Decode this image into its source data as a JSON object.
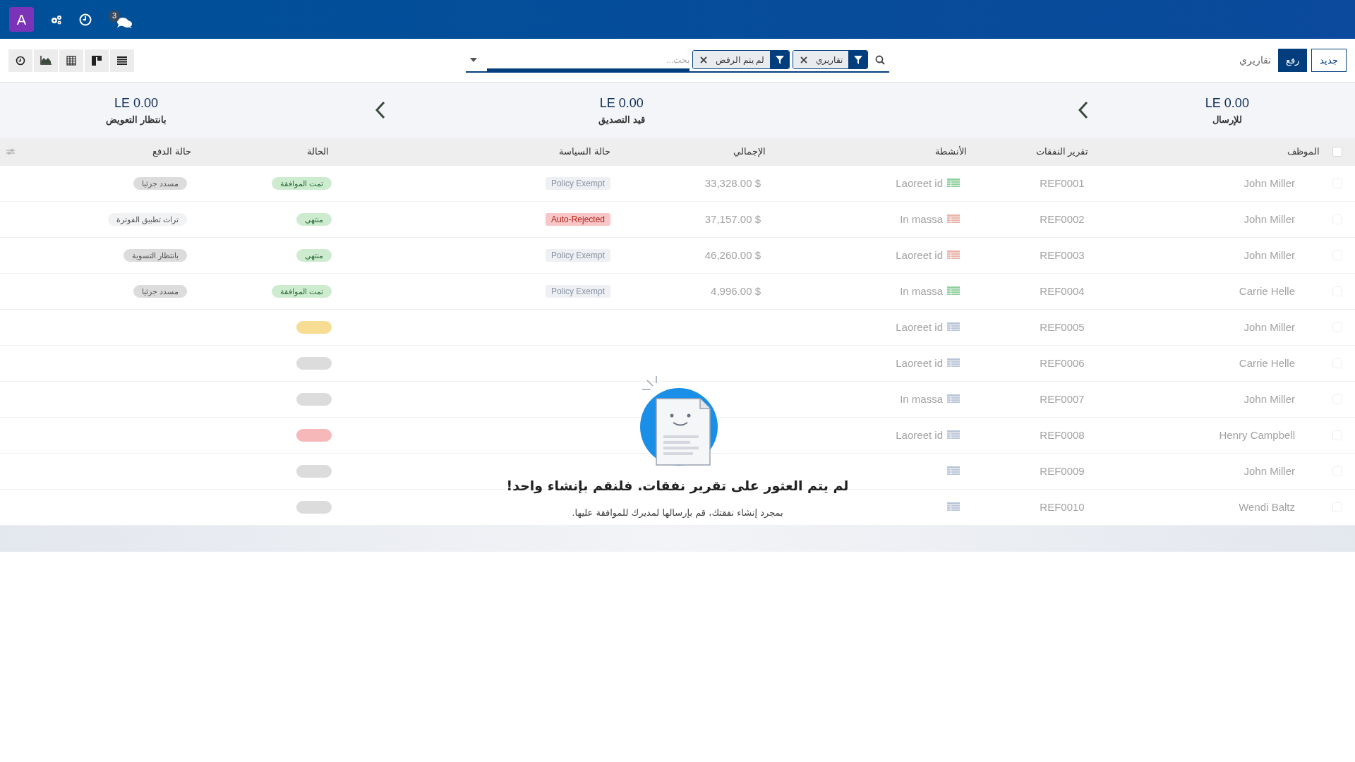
{
  "navbar": {
    "avatar": "A",
    "message_count": "3"
  },
  "breadcrumb": "تقاريري",
  "buttons": [
    {
      "label": "جديد",
      "kind": "outline"
    },
    {
      "label": "رفع",
      "kind": "primary"
    }
  ],
  "search": {
    "placeholder": "بحث...",
    "facets": [
      {
        "label": "تقاريري"
      },
      {
        "label": "لم يتم الرفض"
      }
    ]
  },
  "views": [
    {
      "kind": "activity"
    },
    {
      "kind": "graph"
    },
    {
      "kind": "pivot"
    },
    {
      "kind": "kanban"
    },
    {
      "kind": "list"
    }
  ],
  "stats": [
    {
      "amount": "LE 0.00",
      "label": "للإرسال"
    },
    {
      "amount": "LE 0.00",
      "label": "قيد التصديق"
    },
    {
      "amount": "LE 0.00",
      "label": "بانتظار التعويض"
    }
  ],
  "table": {
    "select_all": {
      "checked": false
    },
    "columns": [
      "الموظف",
      "تقرير النفقات",
      "الأنشطة",
      "الإجمالي",
      "حالة السياسة",
      "الحالة",
      "حالة الدفع"
    ],
    "rows": [
      {
        "checked": false,
        "employee": "John Miller",
        "report": "REF0001",
        "activity": {
          "label": "Laoreet id",
          "color": "#8fd19e"
        },
        "total": "$ 33,328.00",
        "policy": {
          "label": "Policy Exempt",
          "color": "#eef0f3"
        },
        "status": {
          "label": "تمت الموافقة",
          "color": "#cdeccf"
        },
        "payment": {
          "label": "مسدد جزئيا",
          "color": "#dcdcdc"
        }
      },
      {
        "checked": false,
        "employee": "John Miller",
        "report": "REF0002",
        "activity": {
          "label": "In massa",
          "color": "#e8b4a8"
        },
        "total": "$ 37,157.00",
        "policy": {
          "label": "Auto-Rejected",
          "color": "#f8c6c6"
        },
        "status": {
          "label": "منتهي",
          "color": "#cdeccf"
        },
        "payment": {
          "label": "تراث تطبيق الفوترة",
          "color": "#f1f2f4"
        }
      },
      {
        "checked": false,
        "employee": "John Miller",
        "report": "REF0003",
        "activity": {
          "label": "Laoreet id",
          "color": "#e8b4a8"
        },
        "total": "$ 46,260.00",
        "policy": {
          "label": "Policy Exempt",
          "color": "#eef0f3"
        },
        "status": {
          "label": "منتهي",
          "color": "#cdeccf"
        },
        "payment": {
          "label": "بانتظار التسوية",
          "color": "#dcdcdc"
        }
      },
      {
        "checked": false,
        "employee": "Carrie Helle",
        "report": "REF0004",
        "activity": {
          "label": "In massa",
          "color": "#8fd19e"
        },
        "total": "$ 4,996.00",
        "policy": {
          "label": "Policy Exempt",
          "color": "#eef0f3"
        },
        "status": {
          "label": "تمت الموافقة",
          "color": "#cdeccf"
        },
        "payment": {
          "label": "مسدد جزئيا",
          "color": "#dcdcdc"
        }
      },
      {
        "checked": false,
        "employee": "John Miller",
        "report": "REF0005",
        "activity": {
          "label": "Laoreet id",
          "color": "#b9c4d6"
        },
        "status": {
          "color": "#f7dc94"
        }
      },
      {
        "checked": false,
        "employee": "Carrie Helle",
        "report": "REF0006",
        "activity": {
          "label": "Laoreet id",
          "color": "#b9c4d6"
        },
        "status": {
          "color": "#dcdcdc"
        }
      },
      {
        "checked": false,
        "employee": "John Miller",
        "report": "REF0007",
        "activity": {
          "label": "In massa",
          "color": "#b9c4d6"
        },
        "status": {
          "color": "#dcdcdc"
        }
      },
      {
        "checked": false,
        "employee": "Henry Campbell",
        "report": "REF0008",
        "activity": {
          "label": "Laoreet id",
          "color": "#b9c4d6"
        },
        "status": {
          "color": "#f6b8b8"
        }
      },
      {
        "checked": false,
        "employee": "John Miller",
        "report": "REF0009",
        "activity": {
          "color": "#b9c4d6"
        },
        "status": {
          "color": "#dcdcdc"
        }
      },
      {
        "checked": false,
        "employee": "Wendi Baltz",
        "report": "REF0010",
        "activity": {
          "color": "#b9c4d6"
        },
        "status": {
          "color": "#dcdcdc"
        }
      }
    ]
  },
  "empty_state": {
    "title": "لم يتم العثور على تقرير نفقات. فلنقم بإنشاء واحد!",
    "subtitle": "بمجرد إنشاء نفقتك، قم بإرسالها لمديرك للموافقة عليها."
  }
}
